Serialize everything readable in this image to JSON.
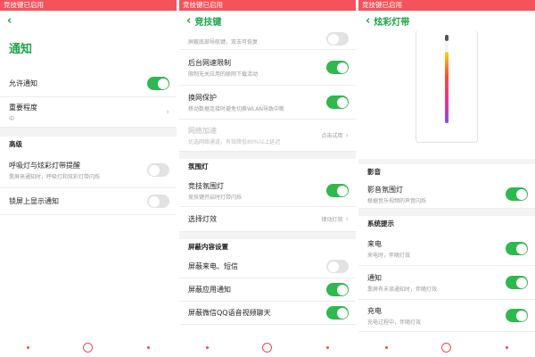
{
  "status_text": "竞技键已启用",
  "screen1": {
    "title": "通知",
    "rows": [
      {
        "label": "允许通知",
        "toggle": "on"
      },
      {
        "label": "重要程度",
        "sub": "中"
      }
    ],
    "section_header": "高级",
    "adv_rows": [
      {
        "label": "呼吸灯与炫彩灯带提醒",
        "sub": "熏屏来通知时，呼吸灯和炫彩灯带闪烁",
        "toggle": "off"
      },
      {
        "label": "锁屏上显示通知",
        "toggle": "off"
      }
    ]
  },
  "screen2": {
    "title": "竞技键",
    "rows": [
      {
        "sub": "屏蔽底部导航键，双击可恢复",
        "toggle": "off"
      },
      {
        "label": "后台网速限制",
        "sub": "限制无关应用的联网下载活动",
        "toggle": "on"
      },
      {
        "label": "换网保护",
        "sub": "移动数据连接时避免切换WLAN导致中断",
        "toggle": "on"
      },
      {
        "label": "网络加速",
        "sub": "优选网络通道，有效降低80%以上延迟",
        "value": "点击试用"
      }
    ],
    "sec_light": "氛围灯",
    "light_rows": [
      {
        "label": "竞技氛围灯",
        "sub": "竞技键开启时灯带闪烁",
        "toggle": "on"
      },
      {
        "label": "选择灯效",
        "value": "律动灯效"
      }
    ],
    "sec_block": "屏蔽内容设置",
    "block_rows": [
      {
        "label": "屏蔽来电、短信",
        "toggle": "off"
      },
      {
        "label": "屏蔽应用通知",
        "toggle": "on"
      },
      {
        "label": "屏蔽微信QQ语音视频聊天",
        "toggle": "on"
      }
    ]
  },
  "screen3": {
    "title": "炫彩灯带",
    "sec_media": "影音",
    "media_rows": [
      {
        "label": "影音氛围灯",
        "sub": "根据音乐视频的声音闪烁",
        "toggle": "on"
      }
    ],
    "sec_sys": "系统提示",
    "sys_rows": [
      {
        "label": "来电",
        "sub": "来电时，伴随灯效",
        "toggle": "on"
      },
      {
        "label": "通知",
        "sub": "熏屏有未读通知时，伴随灯效",
        "toggle": "on"
      },
      {
        "label": "充电",
        "sub": "充电过程中，伴随灯效",
        "toggle": "on"
      }
    ]
  },
  "colors": {
    "accent": "#1fa54a",
    "toggle_on": "#2fb84e",
    "status_bar": "#f4535b"
  },
  "icons": {
    "back": "chevron-left-icon",
    "forward": "chevron-right-icon"
  }
}
